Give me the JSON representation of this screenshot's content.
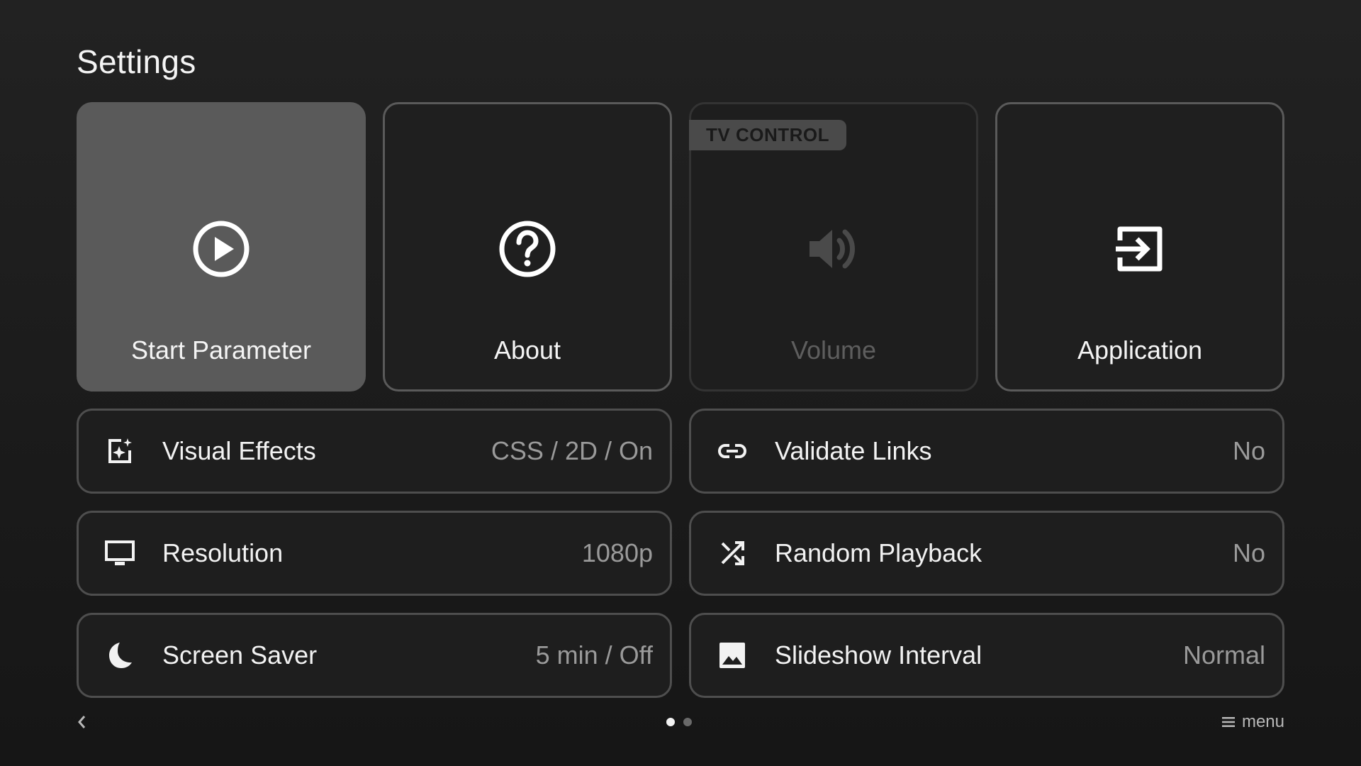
{
  "page": {
    "title": "Settings"
  },
  "tiles": [
    {
      "label": "Start Parameter",
      "icon": "play-circle-icon",
      "state": "focused"
    },
    {
      "label": "About",
      "icon": "help-circle-icon",
      "state": "normal"
    },
    {
      "label": "Volume",
      "icon": "volume-icon",
      "state": "disabled",
      "badge": "TV CONTROL"
    },
    {
      "label": "Application",
      "icon": "exit-to-app-icon",
      "state": "normal"
    }
  ],
  "rows": [
    {
      "label": "Visual Effects",
      "value": "CSS / 2D / On",
      "icon": "sparkle-image-icon"
    },
    {
      "label": "Validate Links",
      "value": "No",
      "icon": "link-icon"
    },
    {
      "label": "Resolution",
      "value": "1080p",
      "icon": "monitor-icon"
    },
    {
      "label": "Random Playback",
      "value": "No",
      "icon": "shuffle-icon"
    },
    {
      "label": "Screen Saver",
      "value": "5 min / Off",
      "icon": "moon-icon"
    },
    {
      "label": "Slideshow Interval",
      "value": "Normal",
      "icon": "image-icon"
    }
  ],
  "footer": {
    "back_icon": "chevron-left-icon",
    "pages_total": 2,
    "page_current": 1,
    "menu_icon": "hamburger-menu-icon",
    "menu_label": "menu"
  },
  "colors": {
    "background": "#1b1b1b",
    "tile_focused": "#5a5a5a",
    "border": "#4e4e4e",
    "text_primary": "#f2f2f2",
    "text_value": "#9a9a9a",
    "text_disabled": "#5e5e5e"
  }
}
